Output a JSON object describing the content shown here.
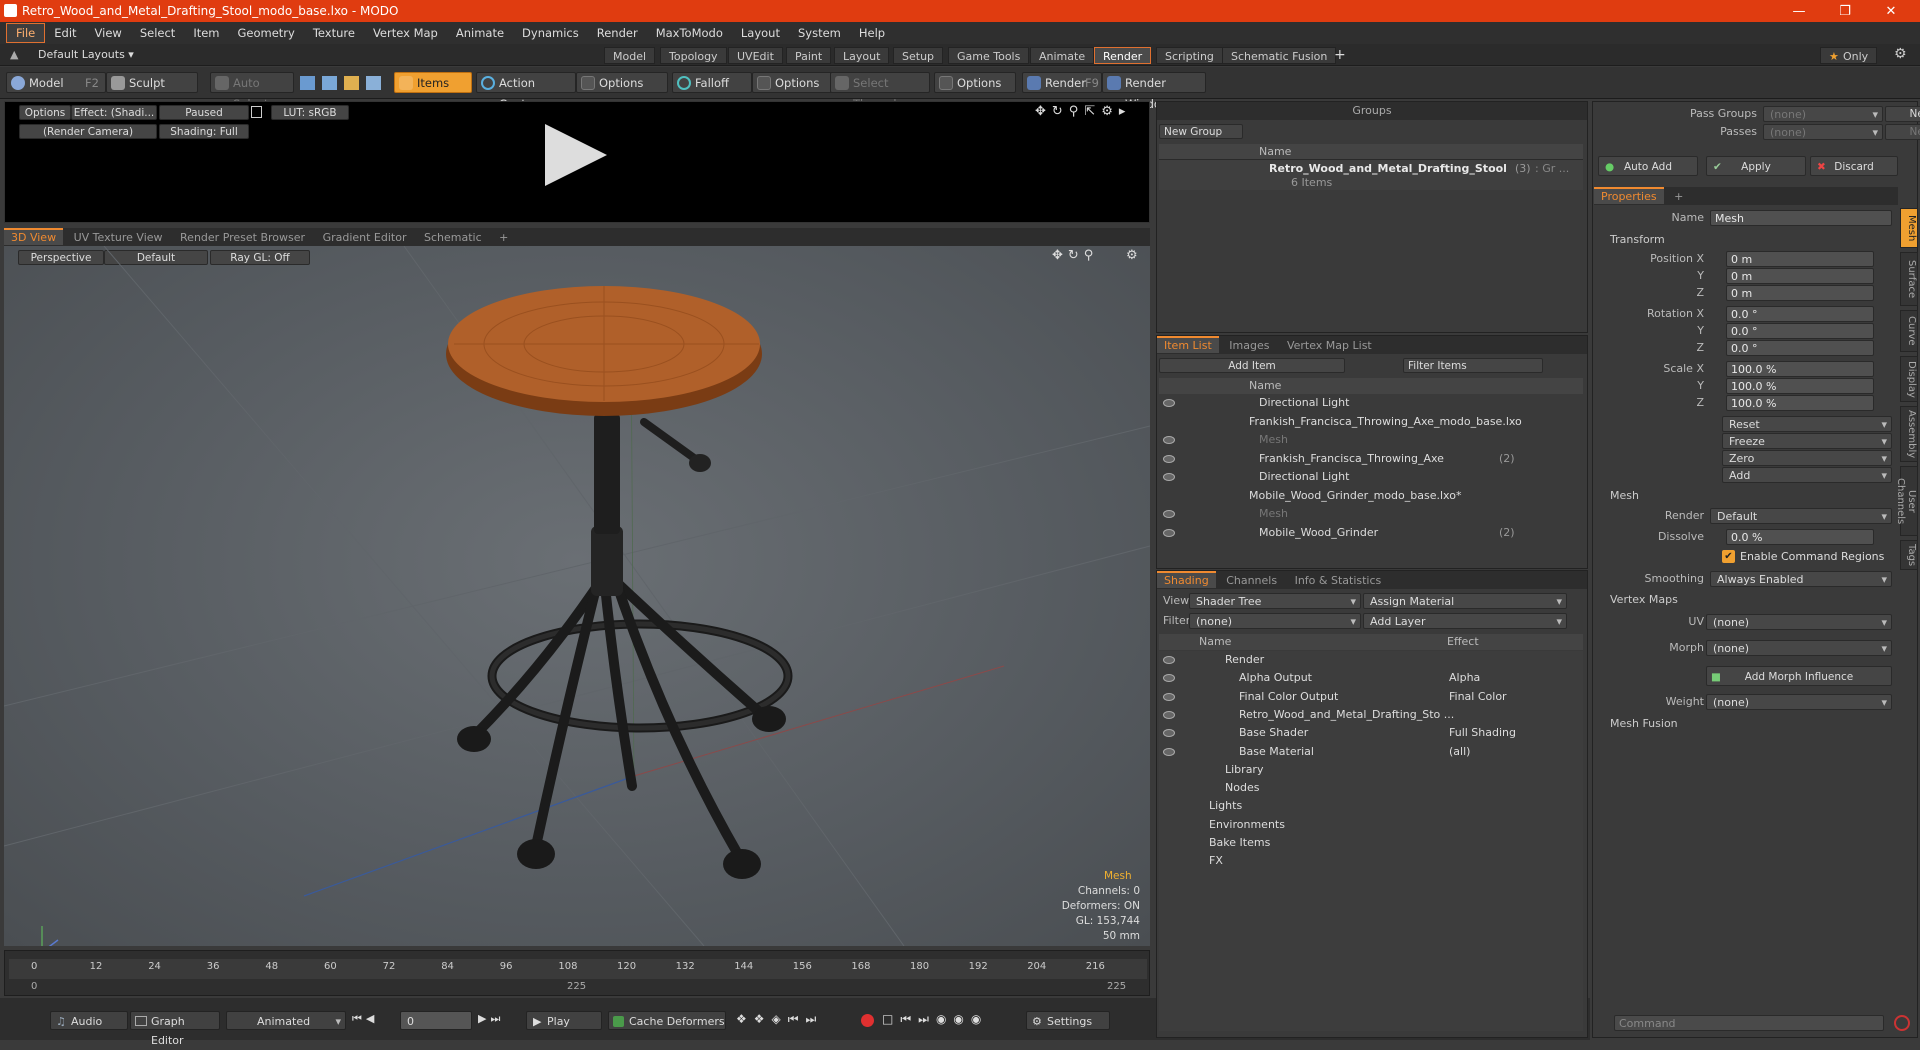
{
  "titlebar": {
    "title": "Retro_Wood_and_Metal_Drafting_Stool_modo_base.lxo - MODO",
    "min": "—",
    "restore": "❐",
    "close": "✕"
  },
  "menu": [
    "File",
    "Edit",
    "View",
    "Select",
    "Item",
    "Geometry",
    "Texture",
    "Vertex Map",
    "Animate",
    "Dynamics",
    "Render",
    "MaxToModo",
    "Layout",
    "System",
    "Help"
  ],
  "layoutbar": {
    "layouts": "Default Layouts ▾",
    "tabs": [
      "Model",
      "Topology",
      "UVEdit",
      "Paint",
      "Layout",
      "Setup",
      "Game Tools",
      "Animate",
      "Render",
      "Scripting",
      "Schematic Fusion"
    ],
    "active_tab": "Render",
    "only": "Only"
  },
  "toolbar": {
    "model": "Model",
    "model_key": "F2",
    "sculpt": "Sculpt",
    "auto_select": "Auto Select",
    "items": "Items",
    "action_center": "Action Center",
    "options1": "Options",
    "falloff": "Falloff",
    "options2": "Options",
    "select_through": "Select Through",
    "options3": "Options",
    "render": "Render",
    "render_key": "F9",
    "render_window": "Render Window"
  },
  "preview": {
    "options": "Options",
    "effect": "Effect: (Shadi...",
    "paused": "Paused",
    "lut": "LUT: sRGB",
    "camera": "(Render Camera)",
    "shading": "Shading: Full"
  },
  "viewport_tabs": [
    "3D View",
    "UV Texture View",
    "Render Preset Browser",
    "Gradient Editor",
    "Schematic"
  ],
  "viewport": {
    "perspective": "Perspective",
    "default": "Default",
    "raygl": "Ray GL: Off",
    "info_title": "Mesh",
    "info": [
      "Channels: 0",
      "Deformers: ON",
      "GL: 153,744",
      "50 mm"
    ]
  },
  "timeline": {
    "ticks": [
      "0",
      "12",
      "24",
      "36",
      "48",
      "60",
      "72",
      "84",
      "96",
      "108",
      "120",
      "132",
      "144",
      "156",
      "168",
      "180",
      "192",
      "204",
      "216"
    ],
    "sub": [
      "0",
      "225",
      "225"
    ]
  },
  "bottom": {
    "audio": "Audio",
    "graph": "Graph Editor",
    "animated": "Animated",
    "frame": "0",
    "play": "Play",
    "cache": "Cache Deformers",
    "settings": "Settings"
  },
  "groups": {
    "title": "Groups",
    "new_group": "New Group",
    "col_name": "Name",
    "item_name": "Retro_Wood_and_Metal_Drafting_Stool",
    "item_count": "(3)",
    "item_suffix": ": Gr ...",
    "item_sub": "6 Items"
  },
  "itemlist": {
    "tabs": [
      "Item List",
      "Images",
      "Vertex Map List"
    ],
    "add_item": "Add Item",
    "filter": "Filter Items",
    "col_name": "Name",
    "rows": [
      {
        "label": "Directional Light",
        "indent": 1,
        "count": ""
      },
      {
        "label": "Frankish_Francisca_Throwing_Axe_modo_base.lxo",
        "indent": 0,
        "count": ""
      },
      {
        "label": "Mesh",
        "indent": 1,
        "count": "",
        "dim": true
      },
      {
        "label": "Frankish_Francisca_Throwing_Axe",
        "indent": 1,
        "count": "(2)"
      },
      {
        "label": "Directional Light",
        "indent": 1,
        "count": ""
      },
      {
        "label": "Mobile_Wood_Grinder_modo_base.lxo*",
        "indent": 0,
        "count": ""
      },
      {
        "label": "Mesh",
        "indent": 1,
        "count": "",
        "dim": true
      },
      {
        "label": "Mobile_Wood_Grinder",
        "indent": 1,
        "count": "(2)"
      }
    ]
  },
  "shading": {
    "tabs": [
      "Shading",
      "Channels",
      "Info & Statistics"
    ],
    "view_label": "View",
    "view": "Shader Tree",
    "assign": "Assign Material",
    "filter_label": "Filter",
    "filter": "(none)",
    "add_layer": "Add Layer",
    "col_name": "Name",
    "col_effect": "Effect",
    "rows": [
      {
        "name": "Render",
        "effect": "",
        "indent": 0
      },
      {
        "name": "Alpha Output",
        "effect": "Alpha",
        "indent": 1
      },
      {
        "name": "Final Color Output",
        "effect": "Final Color",
        "indent": 1
      },
      {
        "name": "Retro_Wood_and_Metal_Drafting_Sto ...",
        "effect": "",
        "indent": 1
      },
      {
        "name": "Base Shader",
        "effect": "Full Shading",
        "indent": 1
      },
      {
        "name": "Base Material",
        "effect": "(all)",
        "indent": 1
      },
      {
        "name": "Library",
        "effect": "",
        "indent": 0
      },
      {
        "name": "Nodes",
        "effect": "",
        "indent": 0
      },
      {
        "name": "Lights",
        "effect": "",
        "indent": -1
      },
      {
        "name": "Environments",
        "effect": "",
        "indent": -1
      },
      {
        "name": "Bake Items",
        "effect": "",
        "indent": -1
      },
      {
        "name": "FX",
        "effect": "",
        "indent": -1
      }
    ]
  },
  "props": {
    "pass_groups": "Pass Groups",
    "passes": "Passes",
    "none": "(none)",
    "new": "New",
    "auto_add": "Auto Add",
    "apply": "Apply",
    "discard": "Discard",
    "tab": "Properties",
    "name_label": "Name",
    "name": "Mesh",
    "transform": "Transform",
    "pos": [
      "0 m",
      "0 m",
      "0 m"
    ],
    "rot": [
      "0.0 °",
      "0.0 °",
      "0.0 °"
    ],
    "scale": [
      "100.0 %",
      "100.0 %",
      "100.0 %"
    ],
    "pos_label": "Position X",
    "rot_label": "Rotation X",
    "scale_label": "Scale X",
    "y": "Y",
    "z": "Z",
    "reset": "Reset",
    "freeze": "Freeze",
    "zero": "Zero",
    "add": "Add",
    "mesh": "Mesh",
    "render_label": "Render",
    "render": "Default",
    "dissolve_label": "Dissolve",
    "dissolve": "0.0 %",
    "enable_cmd": "Enable Command Regions",
    "smoothing_label": "Smoothing",
    "smoothing": "Always Enabled",
    "vmaps": "Vertex Maps",
    "uv_label": "UV",
    "uv": "(none)",
    "morph_label": "Morph",
    "morph": "(none)",
    "add_morph": "Add Morph Influence",
    "weight_label": "Weight",
    "weight": "(none)",
    "mesh_fusion": "Mesh Fusion",
    "command": "Command",
    "vtabs": [
      "Mesh",
      "Surface",
      "Curve",
      "Display",
      "Assembly",
      "User Channels",
      "Tags"
    ]
  }
}
